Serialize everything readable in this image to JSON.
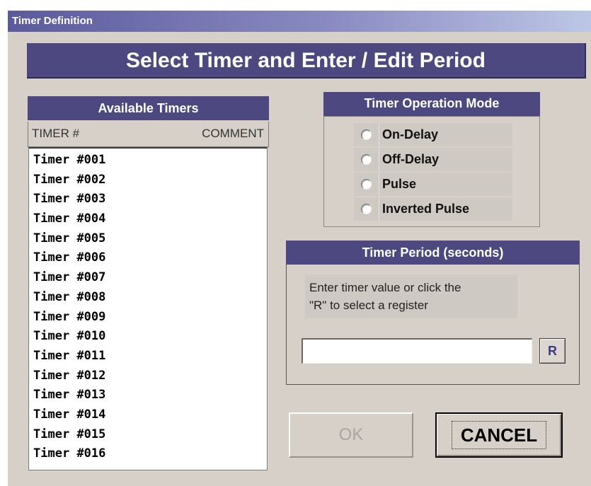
{
  "window": {
    "title": "Timer Definition"
  },
  "banner": {
    "title": "Select Timer and Enter / Edit Period"
  },
  "timers": {
    "header": "Available Timers",
    "columns": [
      "TIMER #",
      "COMMENT"
    ],
    "items": [
      "Timer #001",
      "Timer #002",
      "Timer #003",
      "Timer #004",
      "Timer #005",
      "Timer #006",
      "Timer #007",
      "Timer #008",
      "Timer #009",
      "Timer #010",
      "Timer #011",
      "Timer #012",
      "Timer #013",
      "Timer #014",
      "Timer #015",
      "Timer #016"
    ]
  },
  "mode": {
    "header": "Timer Operation Mode",
    "options": [
      "On-Delay",
      "Off-Delay",
      "Pulse",
      "Inverted Pulse"
    ],
    "selected": null
  },
  "period": {
    "header": "Timer Period (seconds)",
    "hint_line1": "Enter timer value or click the",
    "hint_line2": "\"R\" to select a register",
    "value": "",
    "register_button": "R"
  },
  "buttons": {
    "ok": "OK",
    "cancel": "CANCEL",
    "ok_enabled": false
  }
}
